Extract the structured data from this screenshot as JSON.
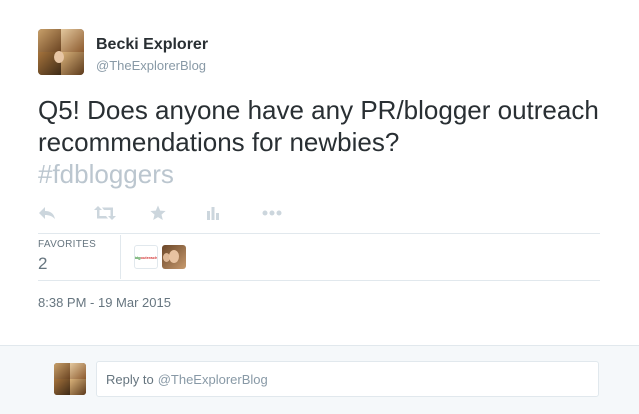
{
  "user": {
    "fullname": "Becki Explorer",
    "username": "@TheExplorerBlog"
  },
  "tweet": {
    "text_main": "Q5! Does anyone have any PR/blogger outreach recommendations for newbies?",
    "hashtag": "#fdbloggers"
  },
  "actions": [
    {
      "name": "reply",
      "icon": "reply-icon"
    },
    {
      "name": "retweet",
      "icon": "retweet-icon"
    },
    {
      "name": "favorite",
      "icon": "star-icon"
    },
    {
      "name": "analytics",
      "icon": "bar-chart-icon"
    },
    {
      "name": "more",
      "icon": "more-dots-icon"
    }
  ],
  "stats": {
    "favorites_label": "FAVORITES",
    "favorites_count": "2",
    "favoriters": [
      {
        "name": "bigoutreach",
        "text_a": "big",
        "text_b": "outreach"
      },
      {
        "name": "user-photo"
      }
    ]
  },
  "timestamp": "8:38 PM - 19 Mar 2015",
  "reply": {
    "prefix": "Reply to",
    "handle": "@TheExplorerBlog"
  },
  "colors": {
    "text": "#292f33",
    "secondary": "#8899a6",
    "hashtag": "#bbc6cf",
    "icon": "#ccd6dd",
    "divider": "#e1e8ed",
    "reply_bg": "#f5f8fa"
  }
}
